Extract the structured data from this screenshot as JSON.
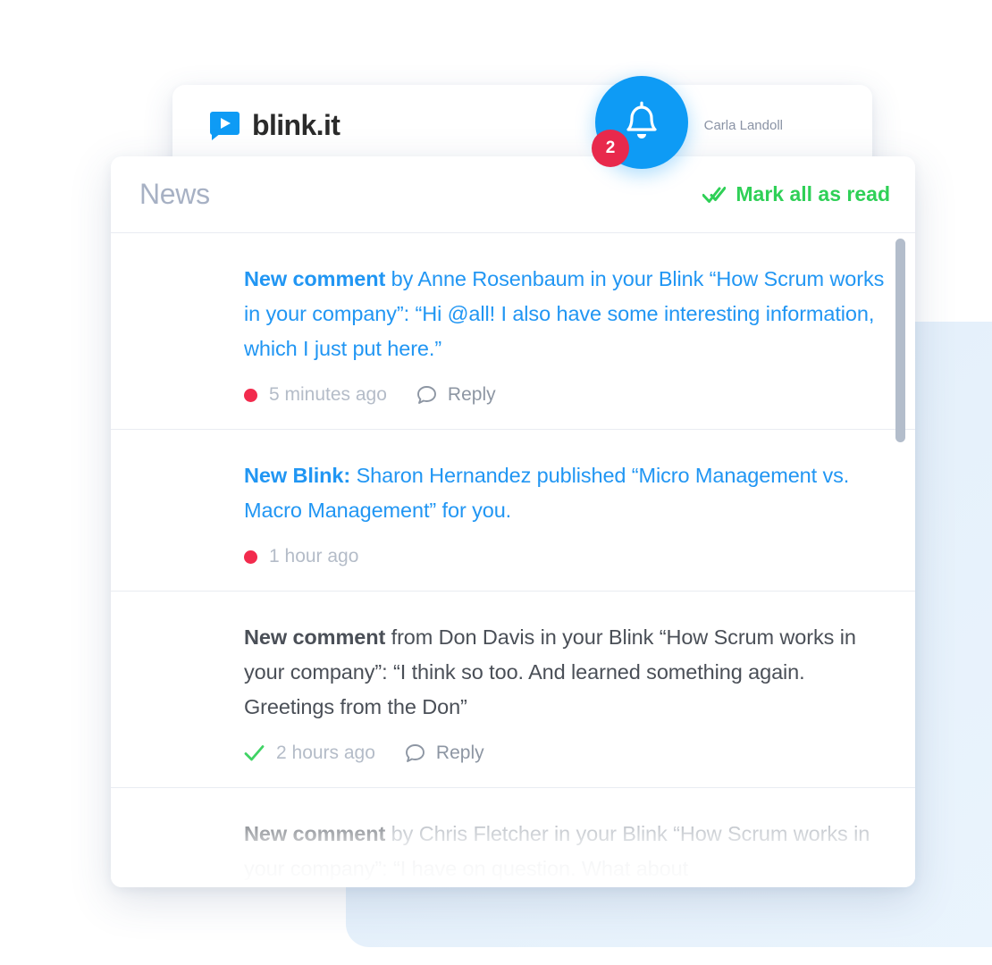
{
  "appbar": {
    "logo_text": "blink.it",
    "logo_icon": "play-bubble-icon",
    "user_name": "Carla Landoll",
    "bell_icon": "bell-icon",
    "bell_badge_count": "2"
  },
  "panel": {
    "title": "News",
    "mark_all_label": "Mark all as read",
    "mark_all_icon": "double-check-icon",
    "accent_green": "#2fd057",
    "accent_blue": "#2196f3",
    "unread_dot_color": "#f22b4d"
  },
  "items": [
    {
      "avatar": "avatar-anne-rosenbaum",
      "state": "unread",
      "lead": "New comment",
      "text": " by Anne Rosenbaum in your Blink “How Scrum works in your company”: “Hi @all! I also have some interesting information, which I just put here.”",
      "time": "5 minutes ago",
      "status_icon": "unread-dot-icon",
      "reply_label": "Reply",
      "reply_icon": "comment-bubble-icon",
      "has_reply": true
    },
    {
      "avatar": "avatar-sharon-hernandez",
      "state": "unread",
      "lead": "New Blink:",
      "text": " Sharon Hernandez published “Micro Management vs. Macro Management” for you.",
      "time": "1 hour ago",
      "status_icon": "unread-dot-icon",
      "reply_label": "",
      "reply_icon": "",
      "has_reply": false
    },
    {
      "avatar": "avatar-don-davis",
      "state": "read",
      "lead": "New comment",
      "text": " from Don Davis in your Blink “How Scrum works in your company”: “I think so too. And learned something again. Greetings from the Don”",
      "time": "2 hours ago",
      "status_icon": "read-check-icon",
      "reply_label": "Reply",
      "reply_icon": "comment-bubble-icon",
      "has_reply": true
    },
    {
      "avatar": "avatar-chris-fletcher",
      "state": "read",
      "lead": "New comment",
      "text": " by Chris Fletcher in your Blink “How Scrum works in your company”: “I have on question. What about",
      "time": "",
      "status_icon": "",
      "reply_label": "",
      "reply_icon": "",
      "has_reply": false
    }
  ]
}
